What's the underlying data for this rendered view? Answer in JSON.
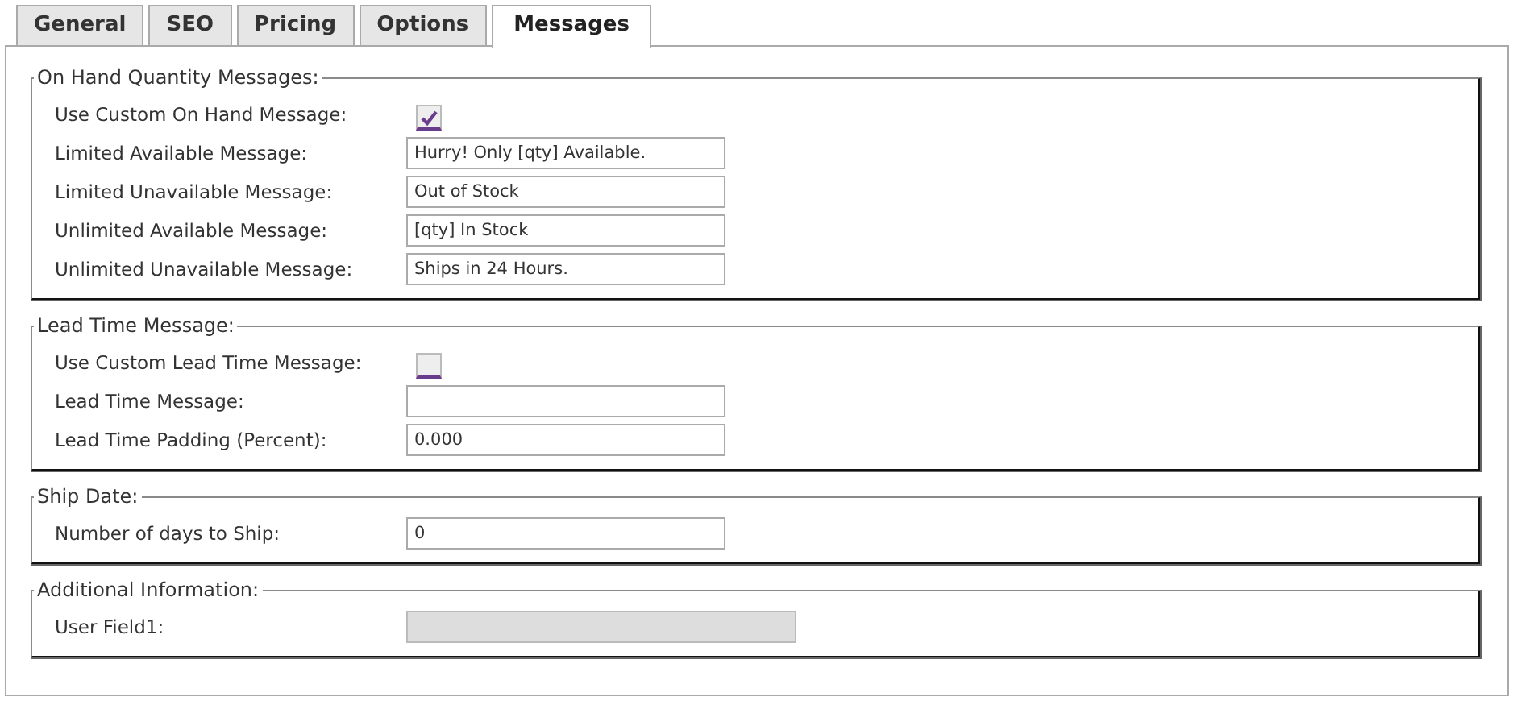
{
  "tabs": [
    {
      "label": "General",
      "selected": false
    },
    {
      "label": "SEO",
      "selected": false
    },
    {
      "label": "Pricing",
      "selected": false
    },
    {
      "label": "Options",
      "selected": false
    },
    {
      "label": "Messages",
      "selected": true
    }
  ],
  "sections": [
    {
      "legend": "On Hand Quantity Messages:",
      "rows": [
        {
          "kind": "checkbox",
          "label": "Use Custom On Hand Message:",
          "checked": true
        },
        {
          "kind": "text",
          "label": "Limited Available Message:",
          "value": "Hurry! Only [qty] Available."
        },
        {
          "kind": "text",
          "label": "Limited Unavailable Message:",
          "value": "Out of Stock"
        },
        {
          "kind": "text",
          "label": "Unlimited Available Message:",
          "value": "[qty] In Stock"
        },
        {
          "kind": "text",
          "label": "Unlimited Unavailable Message:",
          "value": "Ships in 24 Hours."
        }
      ]
    },
    {
      "legend": "Lead Time Message:",
      "rows": [
        {
          "kind": "checkbox",
          "label": "Use Custom Lead Time Message:",
          "checked": false
        },
        {
          "kind": "text",
          "label": "Lead Time Message:"
        },
        {
          "kind": "text",
          "label": "Lead Time Padding (Percent):",
          "value": "0.000"
        }
      ]
    },
    {
      "legend": "Ship Date:",
      "rows": [
        {
          "kind": "text",
          "label": "Number of days to Ship:",
          "value": "0"
        }
      ]
    },
    {
      "legend": "Additional Information:",
      "rows": [
        {
          "kind": "text",
          "label": "User Field1:",
          "disabled": true
        }
      ]
    }
  ]
}
